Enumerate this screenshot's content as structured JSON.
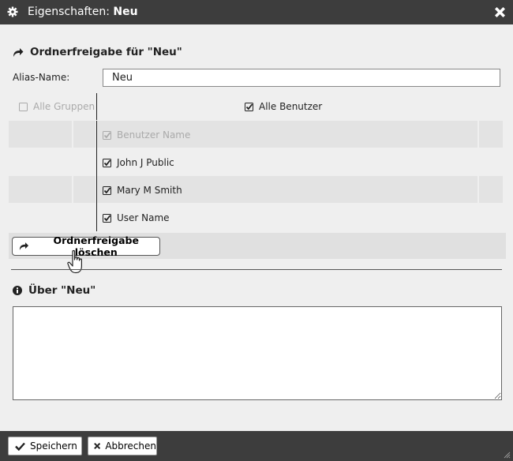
{
  "dialog": {
    "title_prefix": "Eigenschaften:",
    "title_name": "Neu"
  },
  "share": {
    "heading": "Ordnerfreigabe für \"Neu\"",
    "alias_label": "Alias-Name:",
    "alias_value": "Neu",
    "all_groups_label": "Alle Gruppen",
    "all_users_label": "Alle Benutzer",
    "users": [
      {
        "name": "Benutzer Name",
        "checked": true,
        "disabled": true
      },
      {
        "name": "John J Public",
        "checked": true,
        "disabled": false
      },
      {
        "name": "Mary M Smith",
        "checked": true,
        "disabled": false
      },
      {
        "name": "User Name",
        "checked": true,
        "disabled": false
      }
    ],
    "delete_label": "Ordnerfreigabe löschen"
  },
  "about": {
    "heading": "Über \"Neu\"",
    "text": ""
  },
  "footer": {
    "save_label": "Speichern",
    "cancel_label": "Abbrechen"
  },
  "icons": {
    "title": "gear-icon",
    "close": "close-icon",
    "share": "share-arrow-icon",
    "info": "info-icon",
    "save": "checkmark-icon",
    "cancel": "x-icon"
  }
}
